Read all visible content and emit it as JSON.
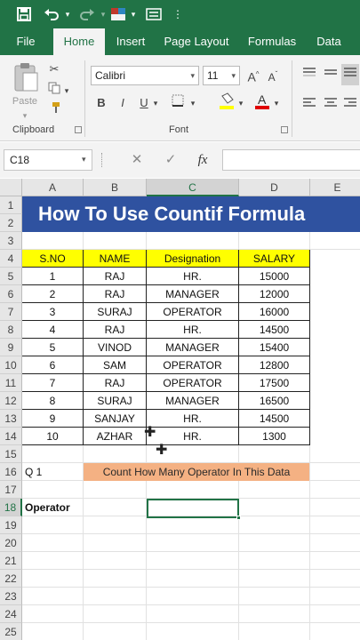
{
  "qat": {
    "save_icon": "save-icon",
    "undo_icon": "undo-icon",
    "redo_icon": "redo-icon",
    "theme_icon": "theme-icon",
    "form_icon": "form-icon",
    "customize_icon": "customize-qat-icon"
  },
  "tabs": [
    "File",
    "Home",
    "Insert",
    "Page Layout",
    "Formulas",
    "Data"
  ],
  "active_tab": "Home",
  "ribbon": {
    "clipboard": {
      "paste_label": "Paste",
      "group_label": "Clipboard"
    },
    "font": {
      "font_name": "Calibri",
      "font_size": "11",
      "bold": "B",
      "italic": "I",
      "underline": "U",
      "group_label": "Font",
      "grow": "A",
      "shrink": "A"
    }
  },
  "formula_bar": {
    "name_box": "C18",
    "fx": "fx",
    "cancel": "✕",
    "enter": "✓",
    "formula": ""
  },
  "columns": [
    "A",
    "B",
    "C",
    "D",
    "E"
  ],
  "selected_column": "C",
  "rows": [
    "1",
    "2",
    "3",
    "4",
    "5",
    "6",
    "7",
    "8",
    "9",
    "10",
    "11",
    "12",
    "13",
    "14",
    "15",
    "16",
    "17",
    "18",
    "19",
    "20",
    "21",
    "22",
    "23",
    "24",
    "25"
  ],
  "selected_row": "18",
  "sheet": {
    "title": "How To Use Countif Formula",
    "headers": [
      "S.NO",
      "NAME",
      "Designation",
      "SALARY"
    ],
    "records": [
      [
        "1",
        "RAJ",
        "HR.",
        "15000"
      ],
      [
        "2",
        "RAJ",
        "MANAGER",
        "12000"
      ],
      [
        "3",
        "SURAJ",
        "OPERATOR",
        "16000"
      ],
      [
        "4",
        "RAJ",
        "HR.",
        "14500"
      ],
      [
        "5",
        "VINOD",
        "MANAGER",
        "15400"
      ],
      [
        "6",
        "SAM",
        "OPERATOR",
        "12800"
      ],
      [
        "7",
        "RAJ",
        "OPERATOR",
        "17500"
      ],
      [
        "8",
        "SURAJ",
        "MANAGER",
        "16500"
      ],
      [
        "9",
        "SANJAY",
        "HR.",
        "14500"
      ],
      [
        "10",
        "AZHAR",
        "HR.",
        "1300"
      ]
    ],
    "question_label": "Q 1",
    "question_text": "Count How Many Operator In This Data",
    "operator_label": "Operator"
  },
  "colors": {
    "excel_green": "#217346",
    "title_blue": "#2f52a0",
    "header_yellow": "#ffff00",
    "question_orange": "#f4b183"
  }
}
